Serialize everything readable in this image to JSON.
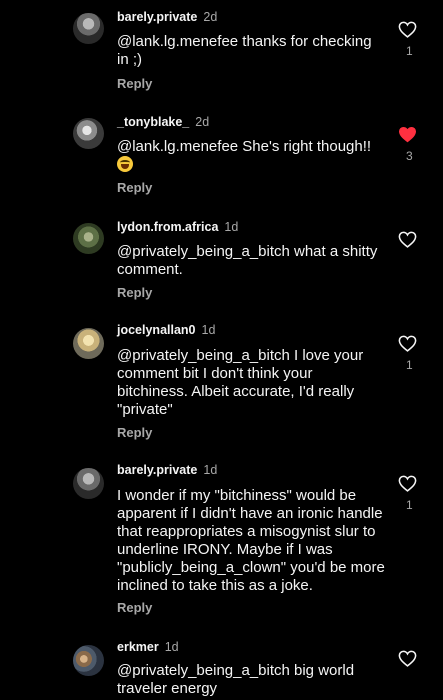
{
  "colors": {
    "background": "#000000",
    "text": "#f5f5f5",
    "muted": "#a8a8a8",
    "liked": "#ff3040"
  },
  "comments": [
    {
      "username": "barely.private",
      "time": "2d",
      "text": "@lank.lg.menefee thanks for checking in ;)",
      "reply": "Reply",
      "likes": "1",
      "liked": false,
      "avatar_icon": "avatar-photo-dark"
    },
    {
      "username": "_tonyblake_",
      "time": "2d",
      "text": "@lank.lg.menefee She's right though!!",
      "emoji": "laughing-face-emoji",
      "reply": "Reply",
      "likes": "3",
      "liked": true,
      "avatar_icon": "avatar-photo-grey"
    },
    {
      "username": "lydon.from.africa",
      "time": "1d",
      "text": "@privately_being_a_bitch what a shitty comment.",
      "reply": "Reply",
      "likes": "",
      "liked": false,
      "avatar_icon": "avatar-photo-green"
    },
    {
      "username": "jocelynallan0",
      "time": "1d",
      "text": "@privately_being_a_bitch I love your comment bit I don't think your bitchiness. Albeit accurate,  I'd really \"private\"",
      "reply": "Reply",
      "likes": "1",
      "liked": false,
      "avatar_icon": "avatar-photo-blonde"
    },
    {
      "username": "barely.private",
      "time": "1d",
      "text": "I wonder if my \"bitchiness\" would be apparent if I didn't have an ironic handle that reappropriates a misogynist slur to  underline IRONY. Maybe if I was \"publicly_being_a_clown\" you'd be more inclined to take this as a joke.",
      "reply": "Reply",
      "likes": "1",
      "liked": false,
      "avatar_icon": "avatar-photo-dark"
    },
    {
      "username": "erkmer",
      "time": "1d",
      "text": "@privately_being_a_bitch big world traveler energy",
      "reply": "",
      "likes": "",
      "liked": false,
      "avatar_icon": "avatar-photo-group"
    }
  ]
}
